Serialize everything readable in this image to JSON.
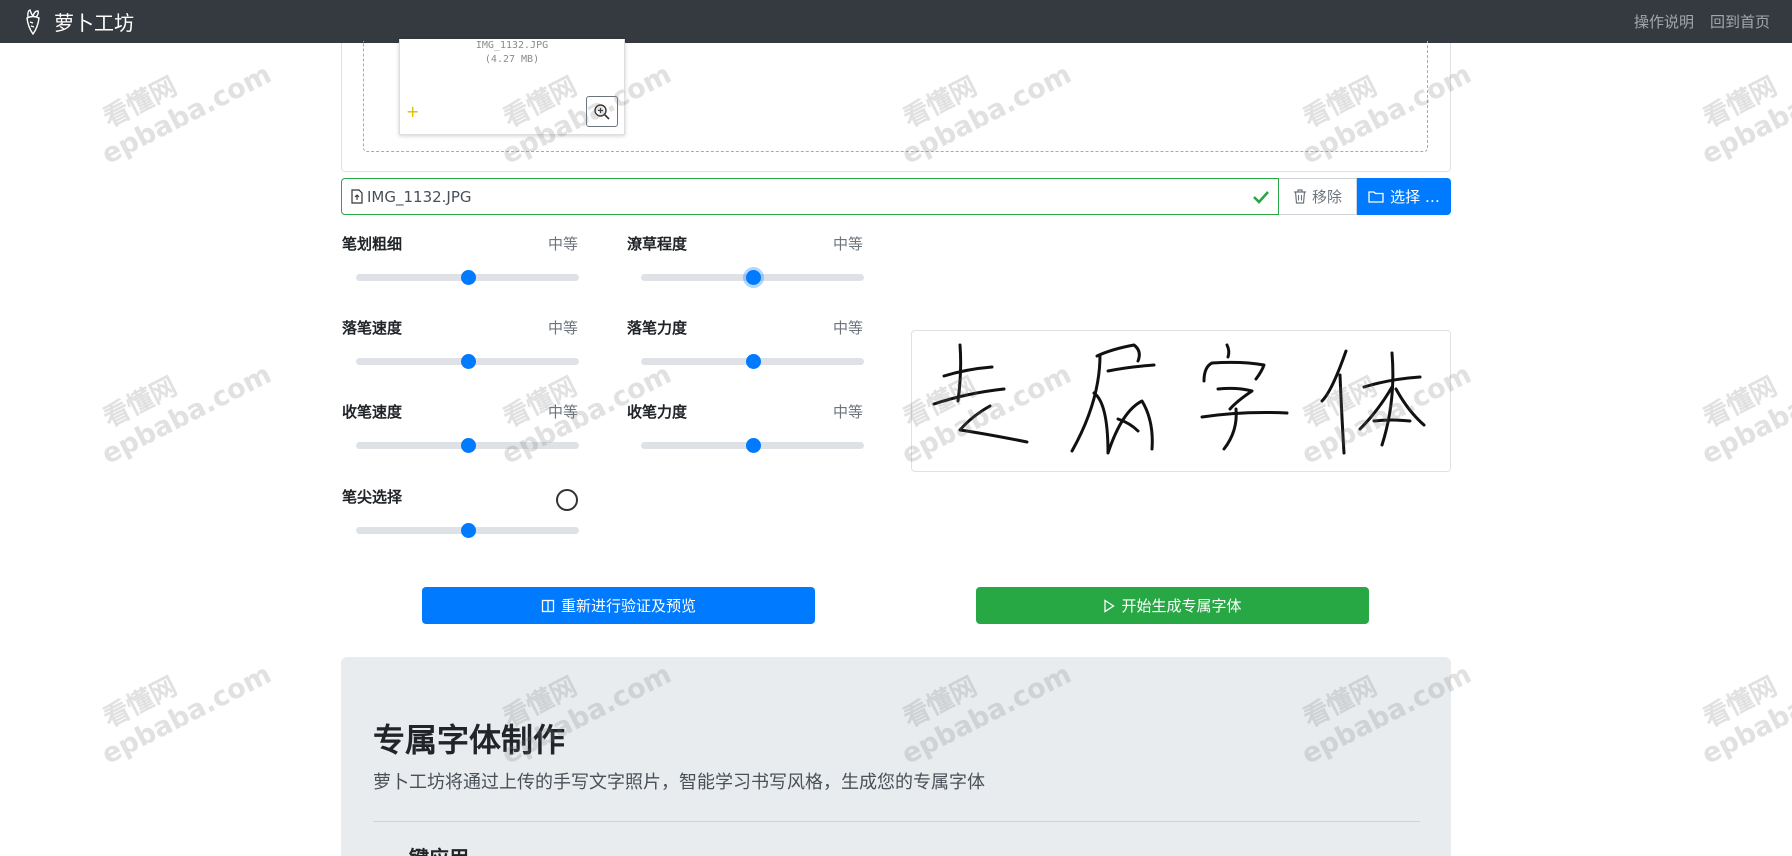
{
  "navbar": {
    "brand": "萝卜工坊",
    "links": [
      "操作说明",
      "回到首页"
    ]
  },
  "upload": {
    "thumb_name": "IMG_1132.JPG",
    "thumb_size": "(4.27 MB)",
    "file_caption": "IMG_1132.JPG",
    "remove_label": "移除",
    "choose_label": "选择 …"
  },
  "sliders": [
    {
      "label": "笔划粗细",
      "value": "中等",
      "level": 0.5
    },
    {
      "label": "潦草程度",
      "value": "中等",
      "level": 0.5
    },
    {
      "label": "落笔速度",
      "value": "中等",
      "level": 0.5
    },
    {
      "label": "落笔力度",
      "value": "中等",
      "level": 0.5
    },
    {
      "label": "收笔速度",
      "value": "中等",
      "level": 0.5
    },
    {
      "label": "收笔力度",
      "value": "中等",
      "level": 0.5
    },
    {
      "label": "笔尖选择",
      "value": "",
      "level": 0.5
    }
  ],
  "preview": {
    "text": "专属字体"
  },
  "actions": {
    "verify_label": "重新进行验证及预览",
    "generate_label": "开始生成专属字体"
  },
  "jumbotron": {
    "title": "专属字体制作",
    "lead": "萝卜工坊将通过上传的手写文字照片，智能学习书写风格，生成您的专属字体",
    "sub": "一键应用"
  },
  "watermark": {
    "line1": "看懂网",
    "line2": "epbaba.com"
  },
  "colors": {
    "navbar": "#343a40",
    "primary": "#007bff",
    "success": "#28a745"
  }
}
